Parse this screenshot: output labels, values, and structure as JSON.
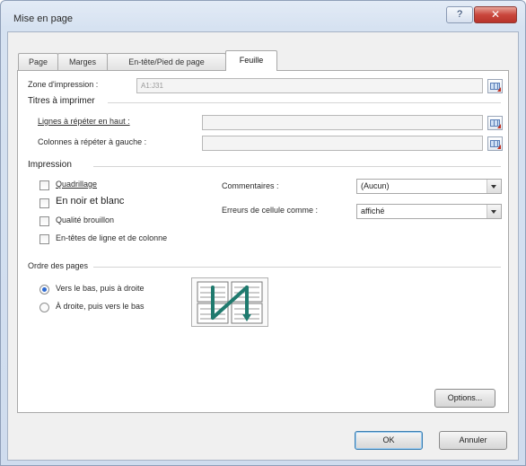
{
  "window": {
    "title": "Mise en page",
    "help_label": "?",
    "close_label": "✕"
  },
  "tabs": [
    {
      "label": "Page"
    },
    {
      "label": "Marges"
    },
    {
      "label": "En-tête/Pied de page"
    },
    {
      "label": "Feuille"
    }
  ],
  "sheet": {
    "print_area_label": "Zone d'impression :",
    "print_area_value": "A1:J31",
    "print_titles_heading": "Titres à imprimer",
    "rows_repeat_label": "Lignes à répéter en haut :",
    "rows_repeat_value": "",
    "cols_repeat_label": "Colonnes à répéter à gauche :",
    "cols_repeat_value": "",
    "print_heading": "Impression",
    "gridlines_label": "Quadrillage",
    "black_white_label": "En noir et blanc",
    "draft_label": "Qualité brouillon",
    "row_col_headings_label": "En-têtes de ligne et de colonne",
    "comments_label": "Commentaires :",
    "comments_value": "(Aucun)",
    "cell_errors_label": "Erreurs de cellule comme :",
    "cell_errors_value": "affiché",
    "page_order_heading": "Ordre des pages",
    "down_then_over_label": "Vers le bas, puis à droite",
    "over_then_down_label": "À droite, puis vers le bas",
    "options_button": "Options..."
  },
  "footer": {
    "ok_label": "OK",
    "cancel_label": "Annuler"
  },
  "state": {
    "gridlines": false,
    "black_white": false,
    "draft": false,
    "row_col_headings": false,
    "page_order": "down_then_over"
  },
  "icons": {
    "range_selector": "range-select-icon",
    "dropdown": "chevron-down-icon",
    "page_order": "page-order-down-then-over-icon"
  },
  "colors": {
    "title_gradient_top": "#e3ebf6",
    "close_button": "#c9463c",
    "accent": "#2d6ad2",
    "page_order_arrow": "#1f7a6e"
  }
}
